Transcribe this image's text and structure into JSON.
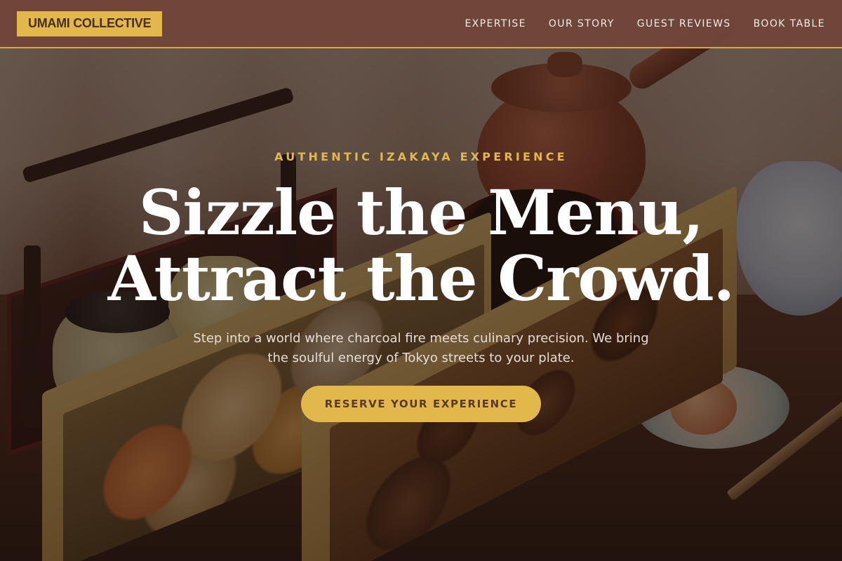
{
  "header": {
    "logo": "UMAMI COLLECTIVE",
    "nav": [
      {
        "label": "EXPERTISE"
      },
      {
        "label": "OUR STORY"
      },
      {
        "label": "GUEST REVIEWS"
      },
      {
        "label": "BOOK TABLE"
      }
    ]
  },
  "hero": {
    "eyebrow": "AUTHENTIC IZAKAYA EXPERIENCE",
    "headline_line1": "Sizzle the Menu,",
    "headline_line2": "Attract the Crowd.",
    "subtext": "Step into a world where charcoal fire meets culinary precision. We bring the soulful energy of Tokyo streets to your plate.",
    "cta_label": "RESERVE YOUR EXPERIENCE",
    "background_image": "japanese-meal-photo"
  },
  "colors": {
    "accent": "#e3b84a",
    "header_bg": "#70463a",
    "header_border": "#d8a84a",
    "cta_text": "#5a3a26"
  }
}
